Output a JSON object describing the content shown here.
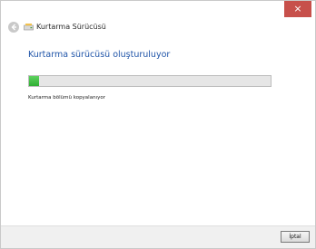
{
  "window": {
    "title": "Kurtarma Sürücüsü",
    "close_label": "×"
  },
  "main": {
    "heading": "Kurtarma sürücüsü oluşturuluyor",
    "progress": 0.04,
    "status": "Kurtarma bölümü kopyalanıyor"
  },
  "footer": {
    "cancel_label": "İptal"
  },
  "icons": {
    "back": "back-arrow-icon",
    "app": "drive-icon",
    "close": "close-icon"
  },
  "colors": {
    "accent_heading": "#1f54a8",
    "close_button": "#c7504b",
    "progress_fill": "#2fae33"
  }
}
